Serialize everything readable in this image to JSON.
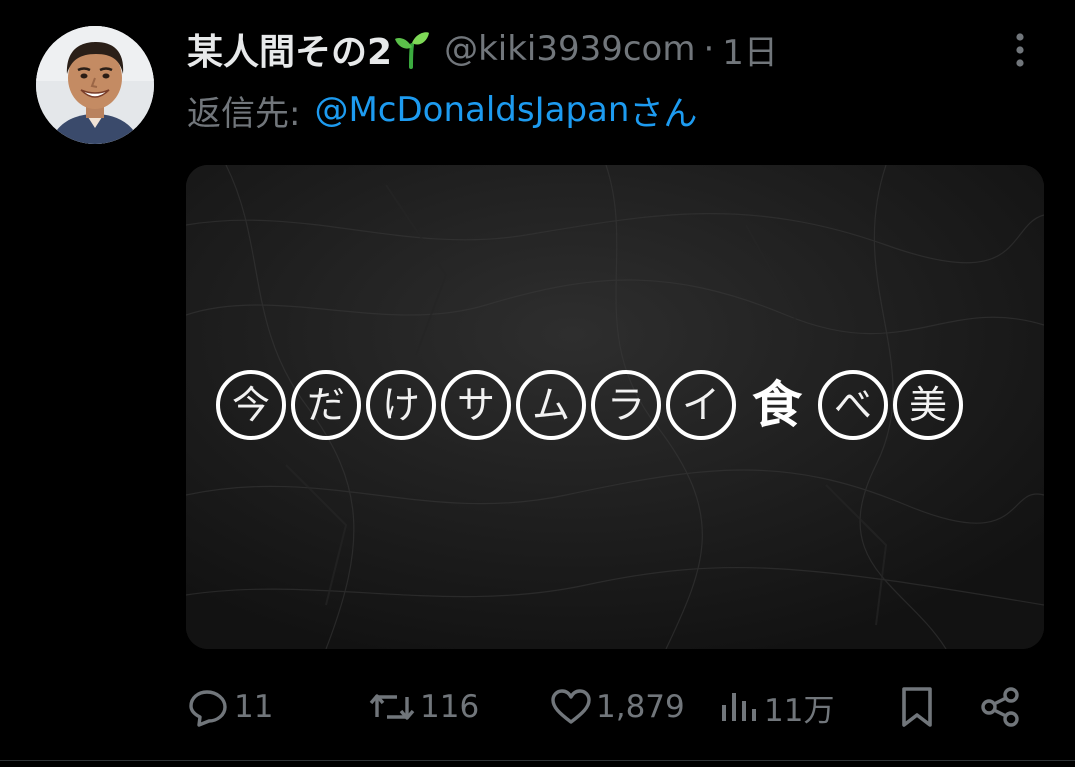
{
  "author": {
    "display_name": "某人間その2",
    "handle": "@kiki3939com",
    "separator": "·",
    "time": "1日",
    "avatar_icon": "user-avatar",
    "name_emoji_icon": "sprout-icon"
  },
  "reply": {
    "prefix": "返信先:",
    "target": "@McDonaldsJapan",
    "suffix": "さん"
  },
  "media": {
    "characters": [
      "今",
      "だ",
      "け",
      "サ",
      "ム",
      "ラ",
      "イ",
      "食",
      "べ",
      "美"
    ],
    "bold_character": "食"
  },
  "actions": {
    "reply_count": "11",
    "retweet_count": "116",
    "like_count": "1,879",
    "view_count": "11万"
  },
  "colors": {
    "background": "#000000",
    "text_primary": "#e7e9ea",
    "text_secondary": "#71767b",
    "link": "#1d9bf0"
  }
}
